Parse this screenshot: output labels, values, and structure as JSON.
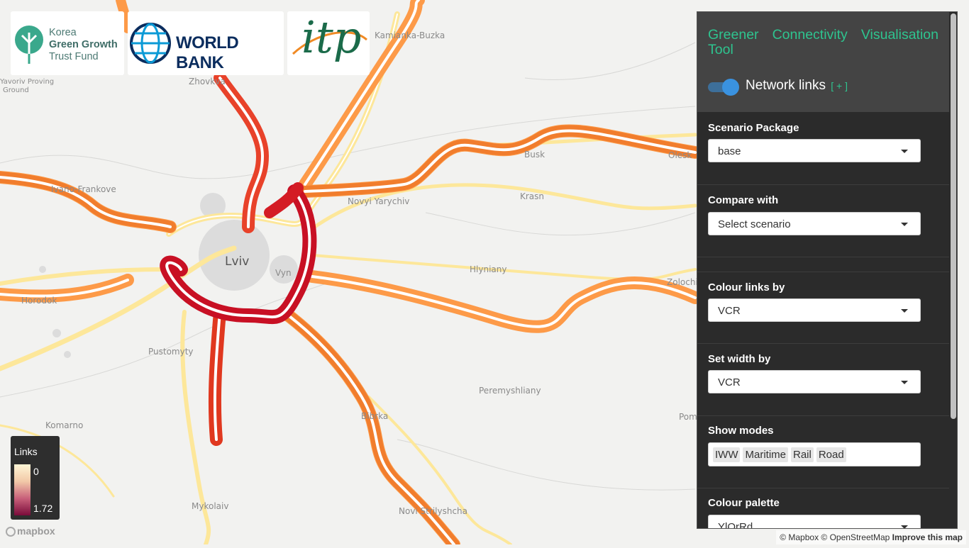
{
  "app": {
    "title": "Greener Connectivity Visualisation Tool",
    "toggle_label": "Network links",
    "toggle_plus": "[ + ]",
    "toggle_on": true
  },
  "logos": {
    "kggtf_line1": "Korea",
    "kggtf_line2": "Green Growth",
    "kggtf_line3": "Trust Fund",
    "worldbank": "WORLD BANK",
    "itp": "itp"
  },
  "controls": {
    "scenario_package": {
      "label": "Scenario Package",
      "value": "base"
    },
    "compare_with": {
      "label": "Compare with",
      "placeholder": "Select scenario"
    },
    "colour_links_by": {
      "label": "Colour links by",
      "value": "VCR"
    },
    "set_width_by": {
      "label": "Set width by",
      "value": "VCR"
    },
    "show_modes": {
      "label": "Show modes",
      "values": [
        "IWW",
        "Maritime",
        "Rail",
        "Road"
      ]
    },
    "colour_palette": {
      "label": "Colour palette",
      "value": "YlOrRd"
    }
  },
  "legend": {
    "title": "Links",
    "min": "0",
    "max": "1.72"
  },
  "places": {
    "lviv": "Lviv",
    "kamianka_buzka": "Kamianka-Buzka",
    "zhovkva": "Zhovkva",
    "ivano_frankove": "Ivano-Frankove",
    "novyi_yarychiv": "Novyi Yarychiv",
    "busk": "Busk",
    "krasne": "Krasn",
    "olesko": "Olesk",
    "vynnyky": "Vyn",
    "hlyniany": "Hlyniany",
    "horodok": "Horodok",
    "pustomyty": "Pustomyty",
    "peremyshliany": "Peremyshliany",
    "bibrka": "Bibrka",
    "komarno": "Komarno",
    "mykolaiv": "Mykolaiv",
    "novi_strilyshcha": "Novi Strilyshcha",
    "zolochiv": "Zolochi",
    "pomoriany": "Pom",
    "proving_line1": "Yavoriv Proving",
    "proving_line2": "Ground",
    "rava": "Zhovkva"
  },
  "map_attribution": {
    "mapbox_logo": "mapbox",
    "text": "© Mapbox © OpenStreetMap",
    "improve": "Improve this map"
  },
  "colors": {
    "panel_bg": "#2b2b2b",
    "accent": "#2ec48f",
    "vcr_low": "#ffeda0",
    "vcr_mid": "#fd8d3c",
    "vcr_high": "#bd0026"
  }
}
